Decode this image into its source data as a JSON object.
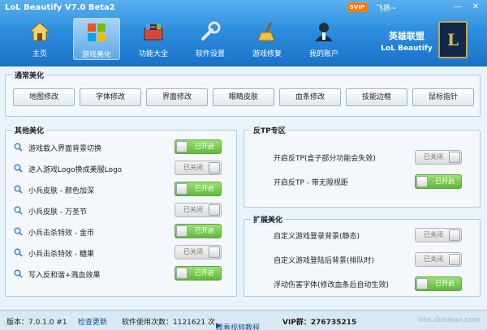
{
  "window": {
    "title": "LoL Beautify V7.0 Beta2",
    "vip_badge": "SVIP",
    "user": "飞扬~",
    "min_icon": "minimize-icon",
    "close_icon": "close-icon"
  },
  "nav": [
    {
      "label": "主页",
      "icon": "home-icon",
      "active": false
    },
    {
      "label": "游戏美化",
      "icon": "windows-logo-icon",
      "active": true
    },
    {
      "label": "功能大全",
      "icon": "toolbox-icon",
      "active": false
    },
    {
      "label": "软件设置",
      "icon": "wrench-icon",
      "active": false
    },
    {
      "label": "游戏修复",
      "icon": "broom-icon",
      "active": false
    },
    {
      "label": "我的账户",
      "icon": "user-icon",
      "active": false
    }
  ],
  "brand": {
    "line1": "英雄联盟",
    "line2": "LoL Beautify",
    "logo_letter": "L"
  },
  "common": {
    "title": "通常美化",
    "buttons": [
      "地图修改",
      "字体修改",
      "界面修改",
      "眼睛皮肤",
      "血条修改",
      "技能边框",
      "鼠标指针"
    ]
  },
  "other": {
    "title": "其他美化",
    "items": [
      {
        "label": "游戏载入界面背景切换",
        "state": "已开启",
        "on": true
      },
      {
        "label": "进入游戏Logo换成美服Logo",
        "state": "已关闭",
        "on": false
      },
      {
        "label": "小兵皮肤 - 颜色加深",
        "state": "已开启",
        "on": true
      },
      {
        "label": "小兵皮肤 - 万圣节",
        "state": "已关闭",
        "on": false
      },
      {
        "label": "小兵击杀特效 - 金币",
        "state": "已开启",
        "on": true
      },
      {
        "label": "小兵击杀特效 - 糖果",
        "state": "已关闭",
        "on": false
      },
      {
        "label": "写入反和谐+溅血效果",
        "state": "已开启",
        "on": true
      }
    ]
  },
  "antitp": {
    "title": "反TP专区",
    "items": [
      {
        "label": "开启反TP(盒子部分功能会失效)",
        "state": "已关闭",
        "on": false
      },
      {
        "label": "开启反TP - 带无限视距",
        "state": "已开启",
        "on": true
      }
    ]
  },
  "extend": {
    "title": "扩展美化",
    "items": [
      {
        "label": "自定义游戏登录背景(静态)",
        "state": "已关闭",
        "on": false
      },
      {
        "label": "自定义游戏登陆后背景(排队时)",
        "state": "已关闭",
        "on": false
      },
      {
        "label": "浮动伤害字体(修改血条后自动生效)",
        "state": "已开启",
        "on": true
      }
    ]
  },
  "status": {
    "version": "版本：7.0.1.0 #1",
    "check_update": "检查更新",
    "usage": "软件使用次数：1121621 次",
    "video": "观看视频教程",
    "vip_group": "VIP群：276735215",
    "watermark": "bbs.duowan.com"
  },
  "colors": {
    "header": "#2d8ee0",
    "toggle_on": "#5fb83a",
    "toggle_off": "#dcdcdc"
  }
}
